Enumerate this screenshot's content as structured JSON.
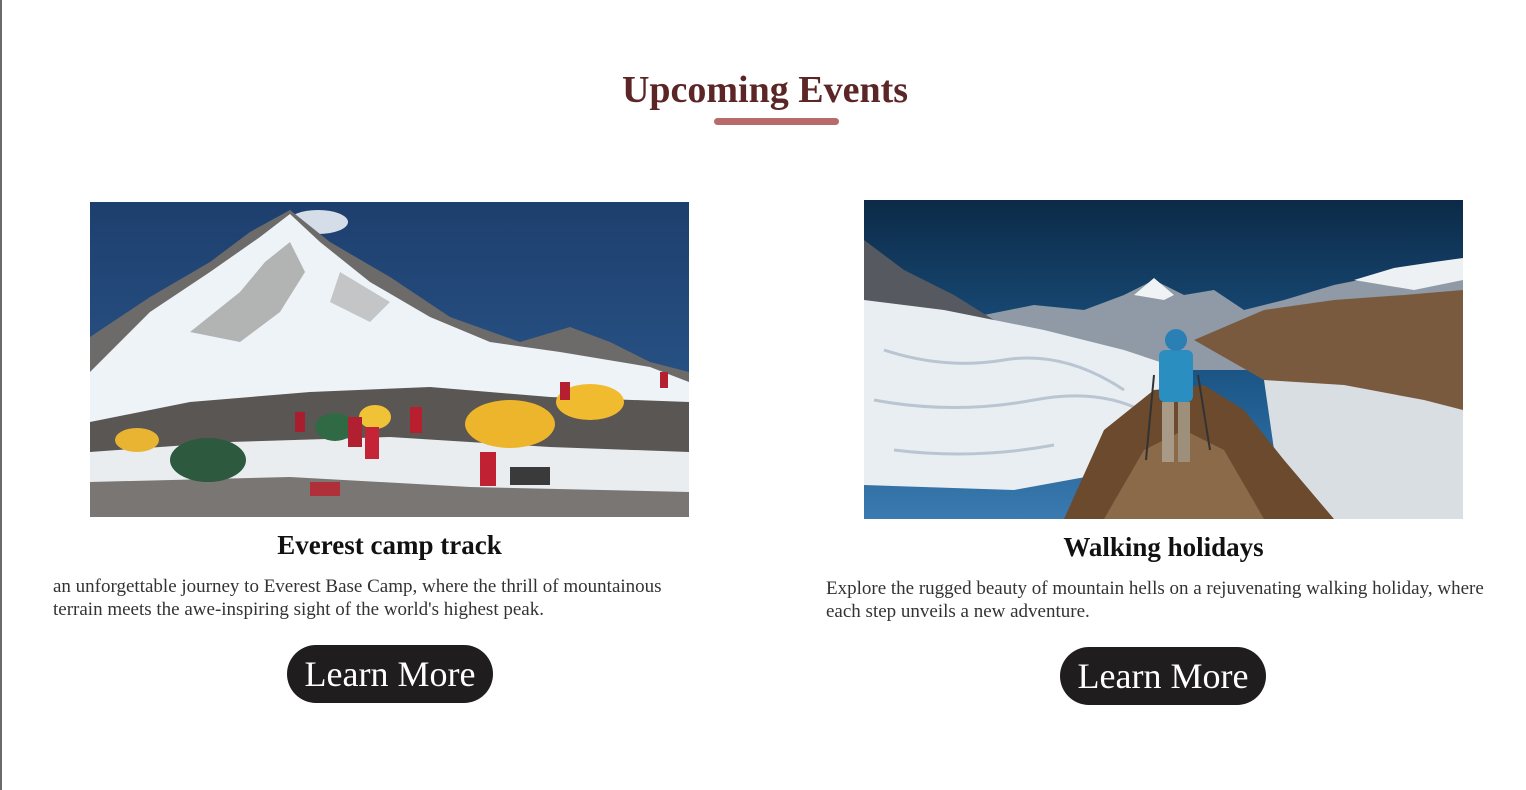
{
  "section": {
    "title": "Upcoming Events",
    "accent_color": "#b86b6b",
    "title_color": "#5c2626"
  },
  "events": [
    {
      "title": "Everest camp track",
      "description": "an unforgettable journey to Everest Base Camp, where the thrill of mountainous terrain meets the awe-inspiring sight of the world's highest peak.",
      "button_label": "Learn More",
      "image": "everest-base-camp-photo"
    },
    {
      "title": "Walking holidays",
      "description": "Explore the rugged beauty of mountain hells on a rejuvenating walking holiday, where each step unveils a new adventure.",
      "button_label": "Learn More",
      "image": "mountain-hiker-photo"
    }
  ],
  "button_color": "#1f1d1d"
}
